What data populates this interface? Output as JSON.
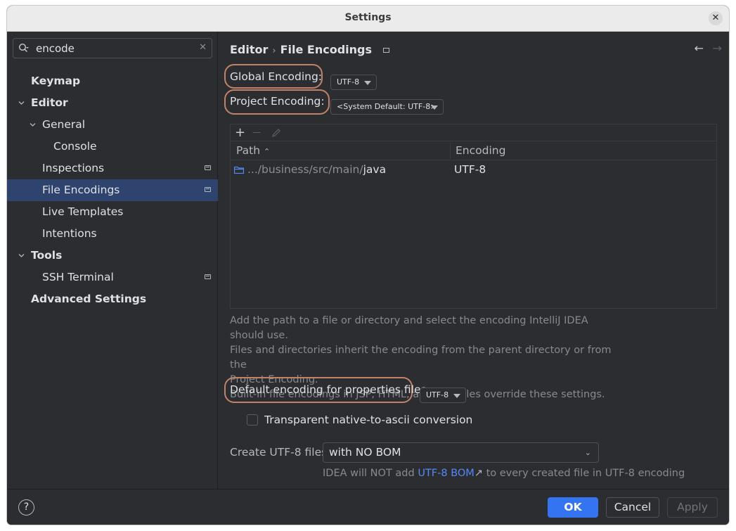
{
  "window": {
    "title": "Settings",
    "close_glyph": "✕"
  },
  "search": {
    "value": "encode",
    "clear_glyph": "✕",
    "icon": "search-icon"
  },
  "sidebar": {
    "items": [
      {
        "label": "Keymap"
      },
      {
        "label": "Editor"
      },
      {
        "label": "General"
      },
      {
        "label": "Console"
      },
      {
        "label": "Inspections"
      },
      {
        "label": "File Encodings"
      },
      {
        "label": "Live Templates"
      },
      {
        "label": "Intentions"
      },
      {
        "label": "Tools"
      },
      {
        "label": "SSH Terminal"
      },
      {
        "label": "Advanced Settings"
      }
    ]
  },
  "breadcrumb": {
    "parent": "Editor",
    "separator": "›",
    "current": "File Encodings",
    "back_glyph": "←",
    "forward_glyph": "→"
  },
  "global_encoding": {
    "label": "Global Encoding:",
    "value": "UTF-8"
  },
  "project_encoding": {
    "label": "Project Encoding:",
    "value": "<System Default: UTF-8>"
  },
  "table": {
    "toolbar": {
      "add": "+",
      "remove": "—",
      "edit_icon": "pencil-icon"
    },
    "columns": {
      "path": "Path",
      "sort_glyph": "⌃",
      "encoding": "Encoding"
    },
    "rows": [
      {
        "path_prefix": ".../business/src/main/",
        "path_name": "java",
        "encoding": "UTF-8"
      }
    ]
  },
  "hint": {
    "line1": "Add the path to a file or directory and select the encoding IntelliJ IDEA should use.",
    "line2": "Files and directories inherit the encoding from the parent directory or from the",
    "line3": "Project Encoding.",
    "line4": "Built-in file encodings in JSP, HTML, and XML files override these settings."
  },
  "properties_encoding": {
    "label": "Default encoding for properties files:",
    "value": "UTF-8"
  },
  "native_to_ascii": {
    "label": "Transparent native-to-ascii conversion",
    "checked": false
  },
  "create_utf8": {
    "label": "Create UTF-8 files:",
    "value": "with NO BOM",
    "chevron": "⌄"
  },
  "bom_note": {
    "before": "IDEA will NOT add ",
    "link": "UTF-8 BOM",
    "arrow": "↗",
    "after": " to every created file in UTF-8 encoding"
  },
  "footer": {
    "help": "?",
    "ok": "OK",
    "cancel": "Cancel",
    "apply": "Apply"
  },
  "colors": {
    "accent": "#3574f0",
    "selection": "#2e436e",
    "highlight_outline": "#c0836a",
    "link": "#548af7"
  }
}
